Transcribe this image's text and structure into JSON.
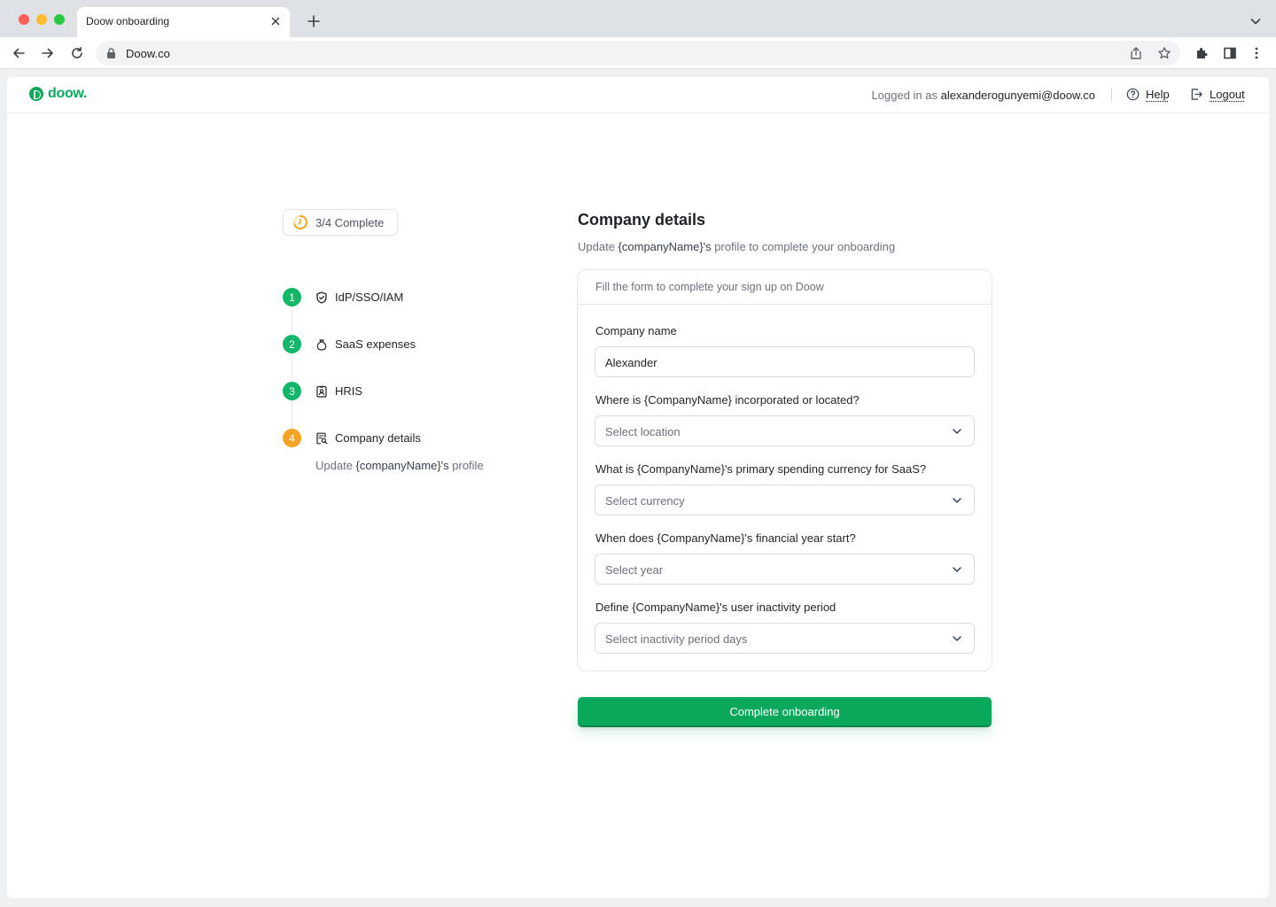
{
  "browser": {
    "tab_title": "Doow onboarding",
    "url": "Doow.co"
  },
  "header": {
    "logo_text": "doow.",
    "logged_in_prefix": "Logged in as",
    "email": "alexanderogunyemi@doow.co",
    "help_label": "Help",
    "logout_label": "Logout"
  },
  "progress": {
    "label": "3/4 Complete",
    "completed": 3,
    "total": 4
  },
  "steps": [
    {
      "number": "1",
      "label": "IdP/SSO/IAM",
      "icon": "shield-check-icon",
      "status": "complete"
    },
    {
      "number": "2",
      "label": "SaaS expenses",
      "icon": "money-bag-icon",
      "status": "complete"
    },
    {
      "number": "3",
      "label": "HRIS",
      "icon": "id-badge-icon",
      "status": "complete"
    },
    {
      "number": "4",
      "label": "Company details",
      "icon": "document-search-icon",
      "status": "current"
    }
  ],
  "step_sub": {
    "prefix": "Update",
    "company": "{companyName}'s",
    "suffix": "profile"
  },
  "form": {
    "title": "Company details",
    "subtitle_prefix": "Update",
    "subtitle_company": "{companyName}'s",
    "subtitle_suffix": "profile to complete your onboarding",
    "card_header": "Fill the form to complete your sign up on Doow",
    "fields": [
      {
        "label": "Company name",
        "value": "Alexander",
        "placeholder": ""
      },
      {
        "label": "Where is {CompanyName} incorporated or located?",
        "value": "",
        "placeholder": "Select location"
      },
      {
        "label": "What is {CompanyName}'s primary spending currency for SaaS?",
        "value": "",
        "placeholder": "Select currency"
      },
      {
        "label": "When does {CompanyName}'s financial year start?",
        "value": "",
        "placeholder": "Select year"
      },
      {
        "label": "Define {CompanyName}'s user inactivity period",
        "value": "",
        "placeholder": "Select inactivity period days"
      }
    ],
    "submit_label": "Complete onboarding"
  },
  "colors": {
    "brand_green": "#0aa85a",
    "step_complete": "#12b76a",
    "step_current": "#f4a324"
  }
}
